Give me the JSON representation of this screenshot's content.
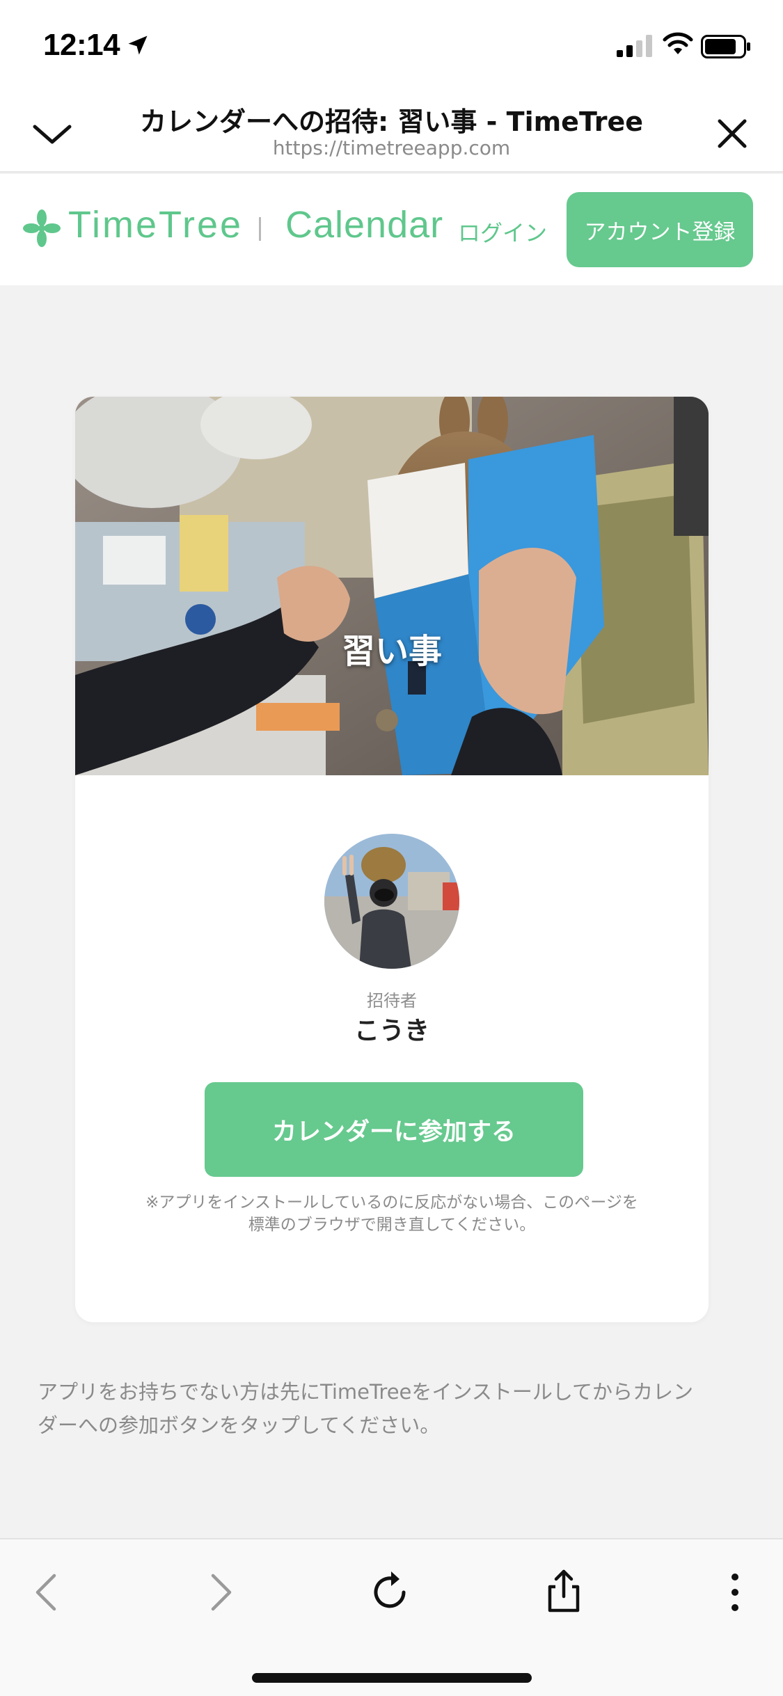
{
  "status_bar": {
    "time": "12:14",
    "icons": [
      "location-arrow-icon",
      "cellular-signal-icon",
      "wifi-icon",
      "battery-icon"
    ]
  },
  "browser_header": {
    "title": "カレンダーへの招待: 習い事 - TimeTree",
    "url": "https://timetreeapp.com",
    "icons": [
      "chevron-down-icon",
      "close-icon"
    ]
  },
  "site_nav": {
    "brand_name": "TimeTree",
    "brand_product": "Calendar",
    "login_label": "ログイン",
    "signup_label": "アカウント登録"
  },
  "invite_card": {
    "calendar_name": "習い事",
    "inviter_label": "招待者",
    "inviter_name": "こうき",
    "join_label": "カレンダーに参加する",
    "install_note_line1": "※アプリをインストールしているのに反応がない場合、このページを",
    "install_note_line2": "標準のブラウザで開き直してください。"
  },
  "footer": {
    "note_line1": "アプリをお持ちでない方は先にTimeTreeをインストールしてからカレン",
    "note_line2": "ダーへの参加ボタンをタップしてください。"
  },
  "toolbar": {
    "icons": [
      "back-icon",
      "forward-icon",
      "reload-icon",
      "share-icon",
      "more-icon"
    ]
  },
  "colors": {
    "brand_green": "#66c98e",
    "page_background": "#f2f2f2",
    "muted_text": "#8a8a8a"
  }
}
